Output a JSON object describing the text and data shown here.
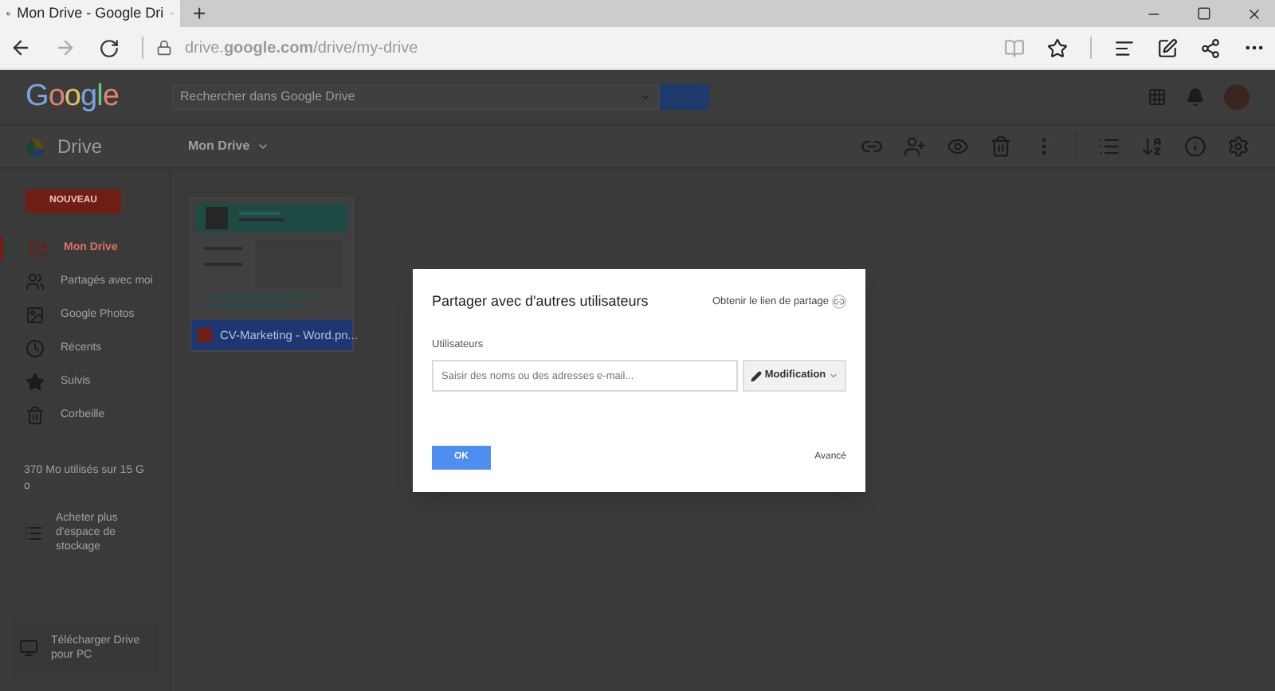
{
  "browser": {
    "tab_title": "Mon Drive - Google Dri",
    "new_tab": "+",
    "url": "drive.**google.com**/drive/my-drive"
  },
  "header": {
    "logo": "Google",
    "search_placeholder": "Rechercher dans Google Drive"
  },
  "toolbar": {
    "app_name": "Drive",
    "breadcrumb": "Mon Drive"
  },
  "sidebar": {
    "new_button": "NOUVEAU",
    "items": [
      {
        "label": "Mon Drive",
        "kind": "drive",
        "selected": true
      },
      {
        "label": "Partagés avec moi",
        "kind": "shared",
        "selected": false
      },
      {
        "label": "Google Photos",
        "kind": "photos",
        "selected": false
      },
      {
        "label": "Récents",
        "kind": "recent",
        "selected": false
      },
      {
        "label": "Suivis",
        "kind": "starred",
        "selected": false
      },
      {
        "label": "Corbeille",
        "kind": "trash",
        "selected": false
      }
    ],
    "storage": "370 Mo utilisés sur 15 Go",
    "upgrade": "Acheter plus d'espace de stockage",
    "download": "Télécharger Drive pour PC"
  },
  "files": [
    {
      "name": "CV-Marketing - Word.pn..."
    }
  ],
  "dialog": {
    "title": "Partager avec d'autres utilisateurs",
    "link_text": "Obtenir le lien de partage",
    "section_label": "Utilisateurs",
    "input_placeholder": "Saisir des noms ou des adresses e-mail...",
    "permission": "Modification",
    "ok": "OK",
    "advanced": "Avancé"
  }
}
